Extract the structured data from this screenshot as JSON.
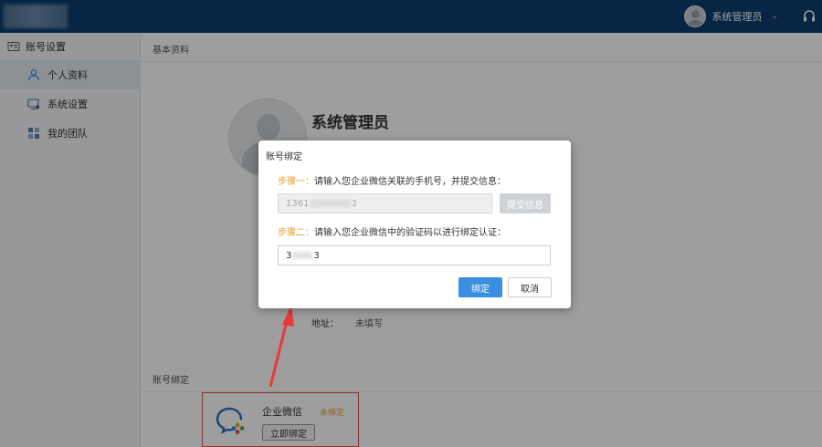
{
  "topbar": {
    "user_name": "系统管理员",
    "caret": "⌄"
  },
  "sidebar": {
    "header": "账号设置",
    "items": [
      {
        "label": "个人资料"
      },
      {
        "label": "系统设置"
      },
      {
        "label": "我的团队"
      }
    ]
  },
  "main": {
    "basic_title": "基本资料",
    "profile_name": "系统管理员",
    "address_label": "地址：",
    "address_value": "未填写",
    "binding_title": "账号绑定",
    "wecom": {
      "name": "企业微信",
      "status": "未绑定",
      "bind_button": "立即绑定"
    }
  },
  "dialog": {
    "title": "账号绑定",
    "step1_tag": "步骤一：",
    "step1_text": "请输入您企业微信关联的手机号，并提交信息：",
    "phone_prefix": "1361",
    "phone_suffix": "3",
    "submit_label": "提交信息",
    "step2_tag": "步骤二：",
    "step2_text": "请输入您企业微信中的验证码以进行绑定认证：",
    "code_prefix": "3",
    "code_suffix": "3",
    "bind_label": "绑定",
    "cancel_label": "取消"
  },
  "colors": {
    "topbar": "#0e3e6e",
    "primary": "#3a8fe0",
    "step_tag": "#e8a03c",
    "highlight": "#e05555"
  }
}
